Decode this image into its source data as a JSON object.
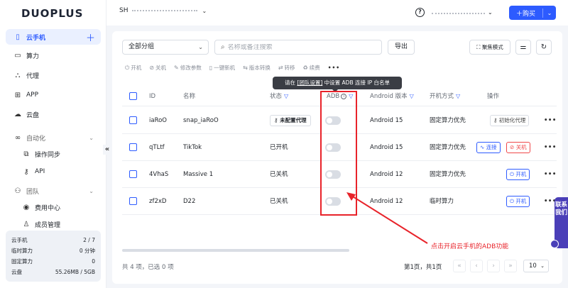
{
  "brand": {
    "logo_text": "DUOPLUS",
    "accent": "#2d5bff"
  },
  "sidebar": {
    "items": [
      {
        "label": "云手机",
        "icon": "phone-icon"
      },
      {
        "label": "算力",
        "icon": "monitor-icon"
      },
      {
        "label": "代理",
        "icon": "network-icon"
      },
      {
        "label": "APP",
        "icon": "apps-grid-icon"
      },
      {
        "label": "云盘",
        "icon": "cloud-icon"
      },
      {
        "label": "自动化",
        "icon": "link-icon"
      },
      {
        "label": "操作同步",
        "icon": "sync-icon"
      },
      {
        "label": "API",
        "icon": "key-icon"
      },
      {
        "label": "团队",
        "icon": "team-icon"
      },
      {
        "label": "费用中心",
        "icon": "coin-icon"
      },
      {
        "label": "成员管理",
        "icon": "member-icon"
      }
    ],
    "usage": [
      {
        "label": "云手机",
        "value": "2 / 7"
      },
      {
        "label": "临时算力",
        "value": "0 分钟"
      },
      {
        "label": "固定算力",
        "value": "0"
      },
      {
        "label": "云盘",
        "value": "55.26MB / 5GB"
      }
    ]
  },
  "topbar": {
    "account_prefix": "SH",
    "buy_label": "＋购买"
  },
  "filters": {
    "group_select": "全部分组",
    "search_placeholder": "名称或备注搜索",
    "export_label": "导出",
    "focus_mode_label": "聚焦模式"
  },
  "toolbar": {
    "actions": [
      "开机",
      "关机",
      "修改参数",
      "一键新机",
      "版本转换",
      "转移",
      "续费"
    ],
    "more": "•••"
  },
  "tooltip": {
    "prefix": "请在 ",
    "link": "[团队设置]",
    "suffix": " 中设置 ADB 连接 IP 白名单"
  },
  "table": {
    "headers": {
      "id": "ID",
      "name": "名称",
      "status": "状态",
      "adb": "ADB",
      "android": "Android 版本",
      "boot_mode": "开机方式",
      "actions": "操作"
    },
    "rows": [
      {
        "id": "iaRoO",
        "name": "snap_iaRoO",
        "status": "未配置代理",
        "android": "Android 15",
        "boot_mode": "固定算力优先",
        "actions": [
          "初始化代理"
        ]
      },
      {
        "id": "qTLtf",
        "name": "TikTok",
        "status": "已开机",
        "android": "Android 15",
        "boot_mode": "固定算力优先",
        "actions": [
          "连接",
          "关机"
        ]
      },
      {
        "id": "4VhaS",
        "name": "Massive 1",
        "status": "已关机",
        "android": "Android 12",
        "boot_mode": "固定算力优先",
        "actions": [
          "开机"
        ]
      },
      {
        "id": "zf2xD",
        "name": "D22",
        "status": "已关机",
        "android": "Android 12",
        "boot_mode": "临时算力",
        "actions": [
          "开机"
        ]
      }
    ]
  },
  "footer": {
    "total": "共 4 项，已选 0 项",
    "page": "第1页，共1页",
    "page_size": "10"
  },
  "annotation": {
    "text": "点击开启云手机的ADB功能",
    "color": "#e8232a"
  },
  "contact": {
    "label": "联系我们"
  }
}
